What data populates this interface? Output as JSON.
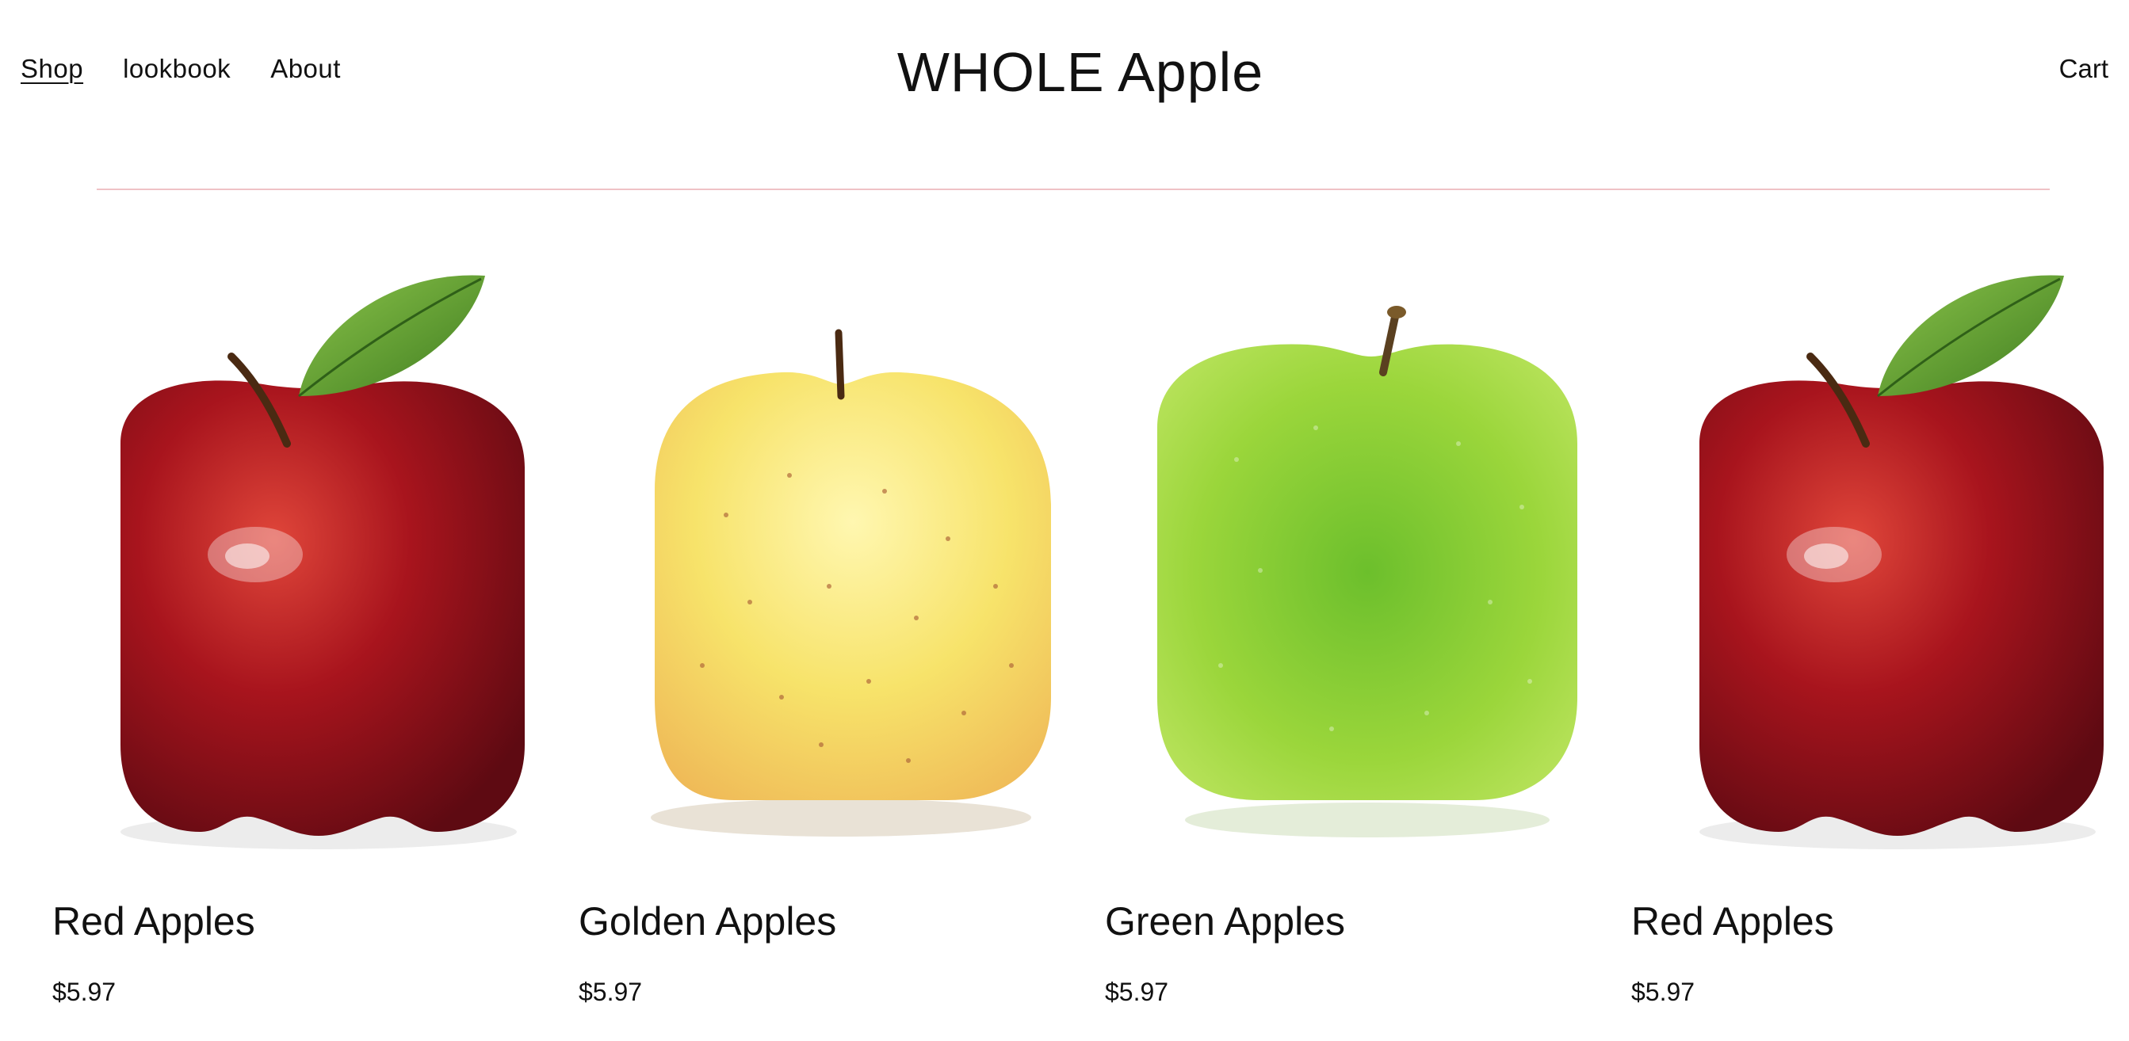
{
  "header": {
    "nav": [
      {
        "label": "Shop",
        "active": true
      },
      {
        "label": "lookbook",
        "active": false
      },
      {
        "label": "About",
        "active": false
      }
    ],
    "title": "WHOLE Apple",
    "cart_label": "Cart"
  },
  "colors": {
    "divider": "#efc2c6",
    "text": "#111111",
    "background": "#ffffff"
  },
  "products": [
    {
      "name": "Red Apples",
      "price": "$5.97",
      "image": "red-apple"
    },
    {
      "name": "Golden Apples",
      "price": "$5.97",
      "image": "golden-apple"
    },
    {
      "name": "Green Apples",
      "price": "$5.97",
      "image": "green-apple"
    },
    {
      "name": "Red Apples",
      "price": "$5.97",
      "image": "red-apple"
    }
  ]
}
